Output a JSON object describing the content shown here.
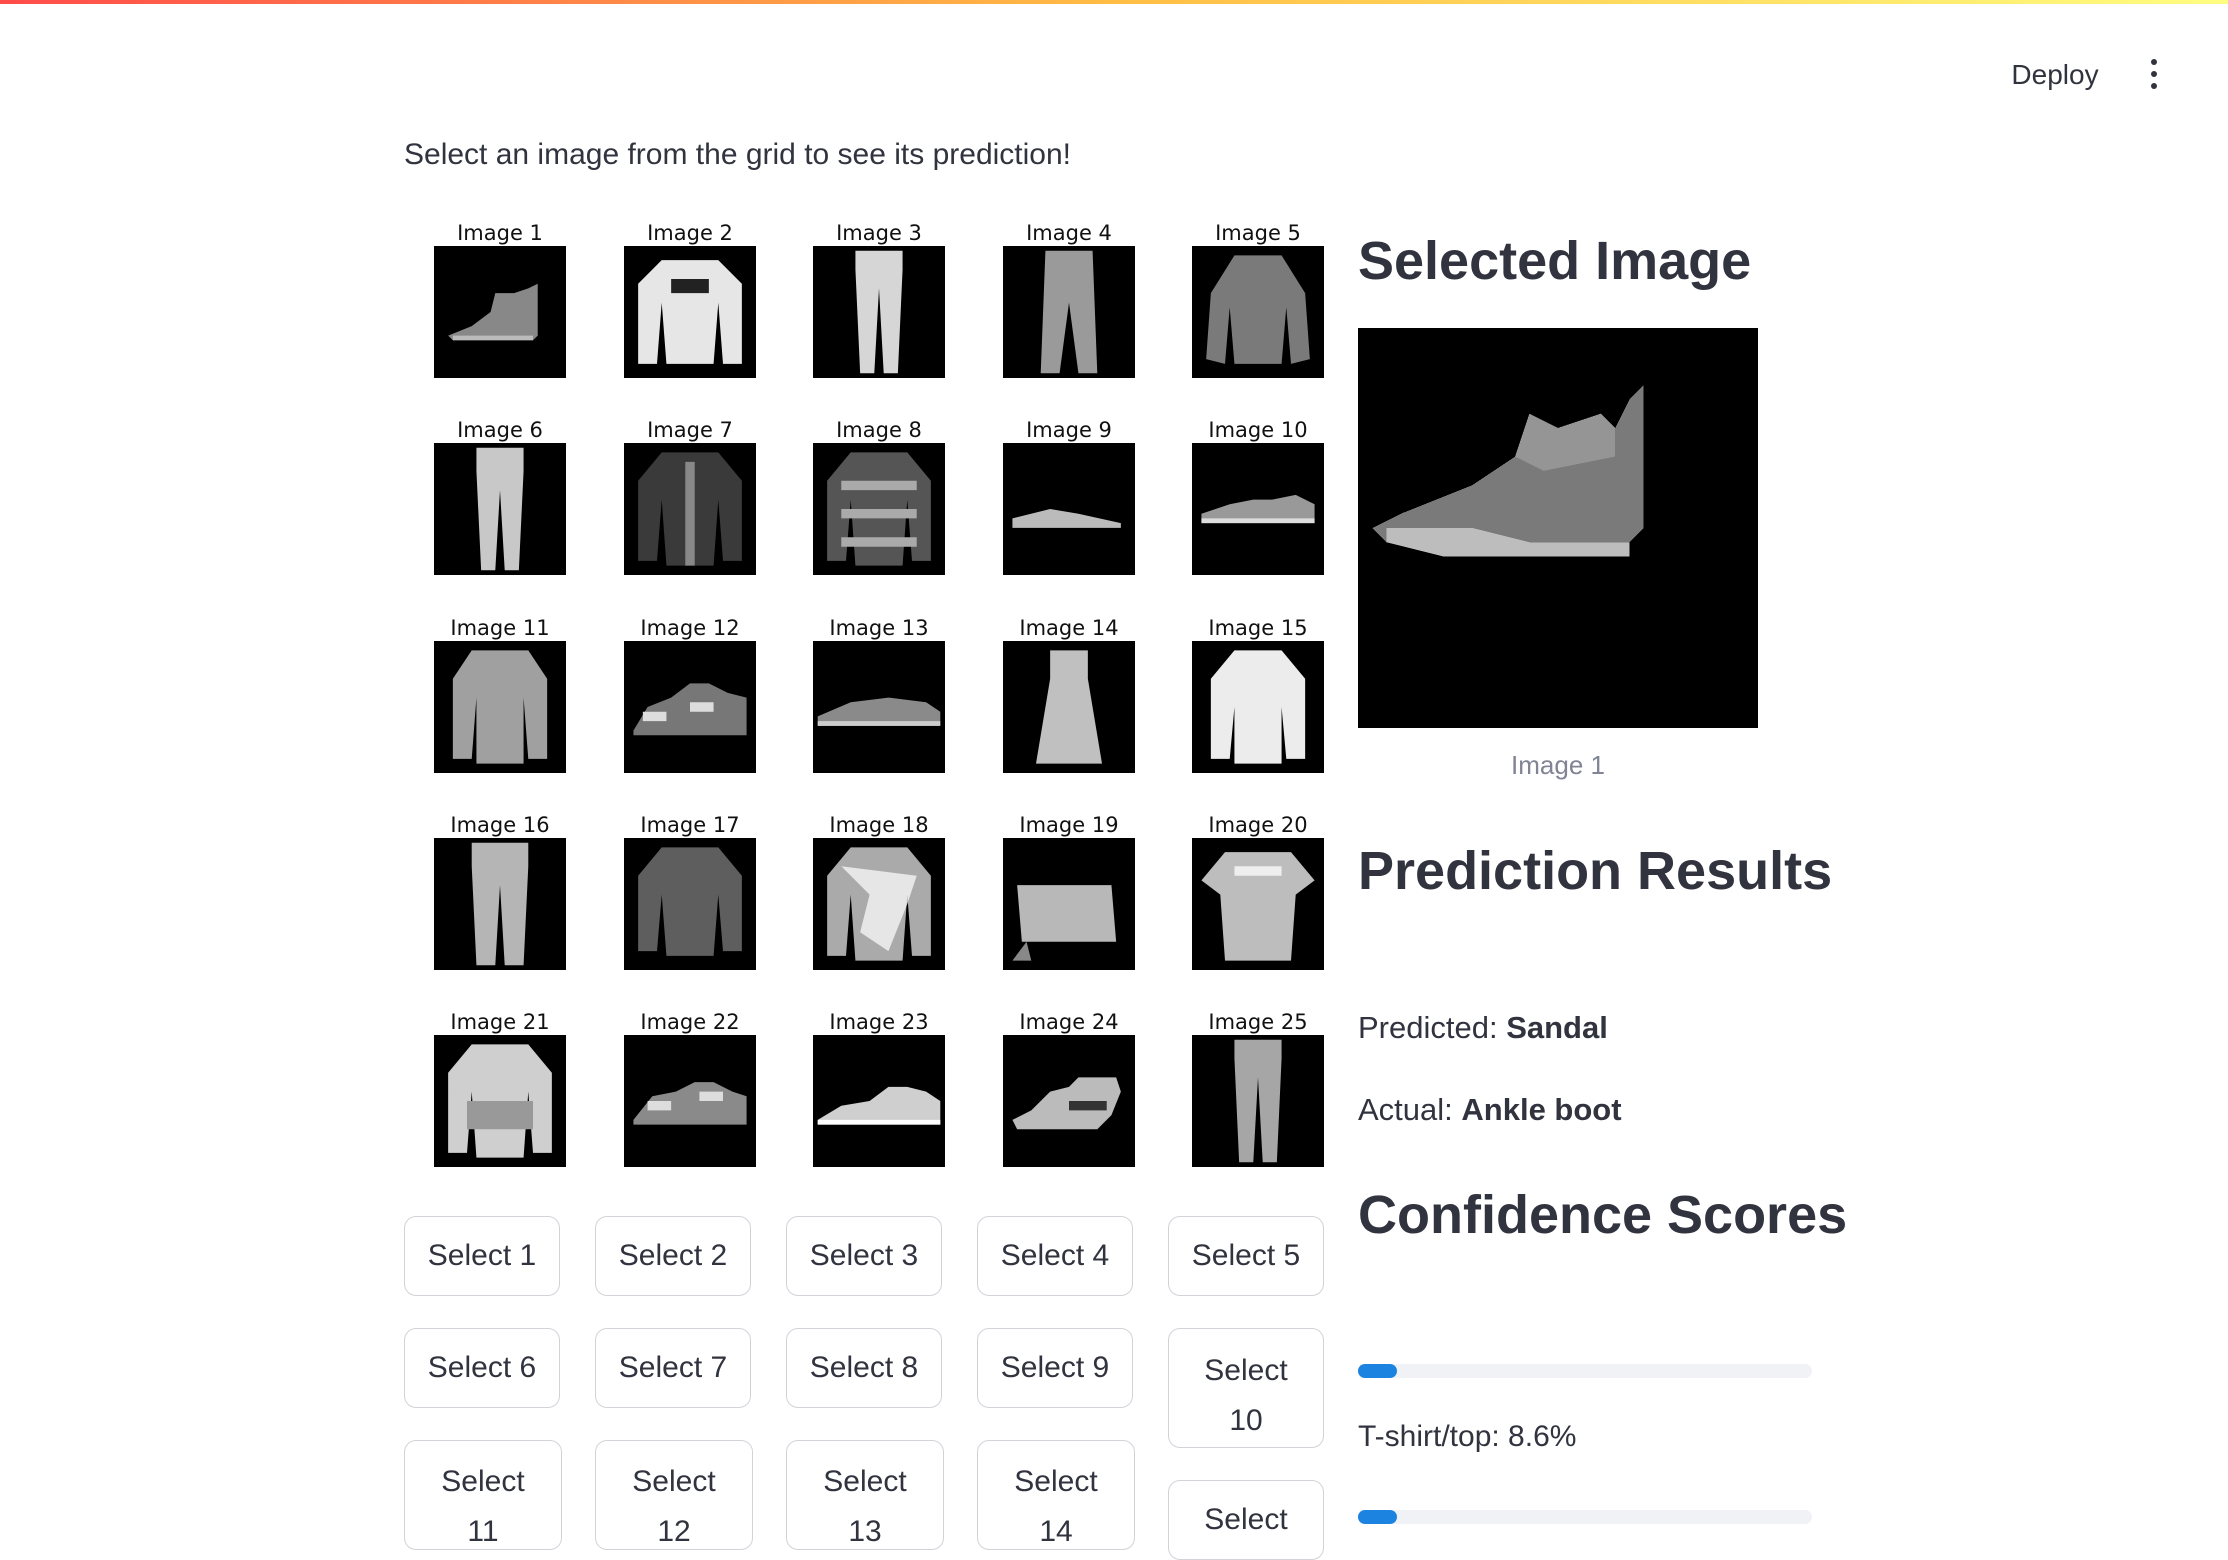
{
  "header": {
    "deploy_label": "Deploy"
  },
  "intro_text": "Select an image from the grid to see its prediction!",
  "grid": {
    "captions": [
      "Image 1",
      "Image 2",
      "Image 3",
      "Image 4",
      "Image 5",
      "Image 6",
      "Image 7",
      "Image 8",
      "Image 9",
      "Image 10",
      "Image 11",
      "Image 12",
      "Image 13",
      "Image 14",
      "Image 15",
      "Image 16",
      "Image 17",
      "Image 18",
      "Image 19",
      "Image 20",
      "Image 21",
      "Image 22",
      "Image 23",
      "Image 24",
      "Image 25"
    ]
  },
  "buttons": {
    "labels": [
      "Select 1",
      "Select 2",
      "Select 3",
      "Select 4",
      "Select 5",
      "Select 6",
      "Select 7",
      "Select 8",
      "Select 9",
      "Select 10",
      "Select 11",
      "Select 12",
      "Select 13",
      "Select 14",
      "Select"
    ]
  },
  "selected": {
    "heading": "Selected Image",
    "caption": "Image 1"
  },
  "prediction": {
    "heading": "Prediction Results",
    "predicted_label": "Predicted:",
    "predicted_value": "Sandal",
    "actual_label": "Actual:",
    "actual_value": "Ankle boot"
  },
  "confidence": {
    "heading": "Confidence Scores",
    "scores": [
      {
        "label": "T-shirt/top: 8.6%",
        "value": 0.086
      },
      {
        "label": "",
        "value": 0.086
      }
    ]
  }
}
